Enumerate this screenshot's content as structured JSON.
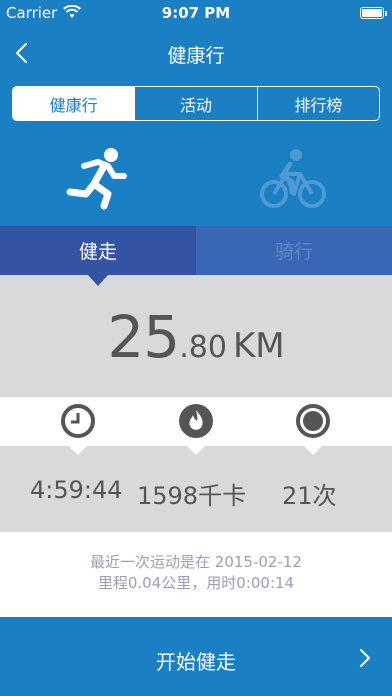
{
  "status_bar": {
    "carrier": "Carrier",
    "time": "9:07 PM"
  },
  "nav": {
    "title": "健康行"
  },
  "segments": [
    {
      "label": "健康行",
      "active": true
    },
    {
      "label": "活动",
      "active": false
    },
    {
      "label": "排行榜",
      "active": false
    }
  ],
  "mode_tabs": {
    "walk": "健走",
    "ride": "骑行",
    "selected": "walk"
  },
  "distance": {
    "whole": "25",
    "fraction": ".80",
    "unit": "KM"
  },
  "stats": {
    "duration": "4:59:44",
    "calories": "1598千卡",
    "count": "21次"
  },
  "last_activity": {
    "line1": "最近一次运动是在 2015-02-12",
    "line2": "里程0.04公里，用时0:00:14"
  },
  "start_button": {
    "label": "开始健走"
  },
  "icons": {
    "status": [
      "wifi-icon",
      "battery-icon"
    ],
    "nav": [
      "back-chevron-icon"
    ],
    "modes": [
      "runner-icon",
      "cyclist-icon"
    ],
    "stats": [
      "clock-icon",
      "flame-icon",
      "record-icon"
    ],
    "start": [
      "chevron-right-icon"
    ]
  },
  "colors": {
    "primary": "#1b7fc4",
    "tab_active": "#3254a3",
    "panel_gray": "#d9d9d9",
    "stat_icon": "#555555"
  }
}
